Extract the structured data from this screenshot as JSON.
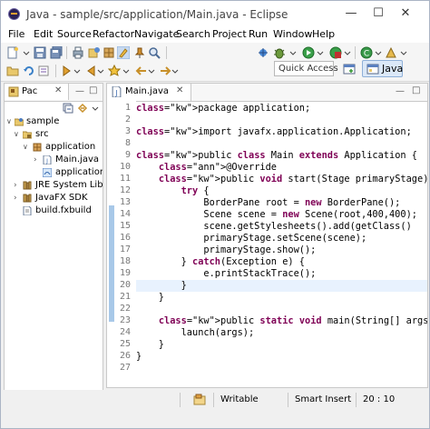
{
  "window": {
    "title": "Java - sample/src/application/Main.java - Eclipse"
  },
  "window_controls": [
    "minimize",
    "maximize",
    "close"
  ],
  "menu": [
    "File",
    "Edit",
    "Source",
    "Refactor",
    "Navigate",
    "Search",
    "Project",
    "Run",
    "Window",
    "Help"
  ],
  "toolbar": {
    "quick_access_placeholder": "Quick Access",
    "perspective_label": "Java"
  },
  "package_explorer": {
    "tab_label": "Pac",
    "tree": [
      {
        "label": "sample",
        "icon": "project-icon",
        "depth": 0,
        "expanded": true
      },
      {
        "label": "src",
        "icon": "source-folder-icon",
        "depth": 1,
        "expanded": true
      },
      {
        "label": "application",
        "icon": "package-icon",
        "depth": 2,
        "expanded": true
      },
      {
        "label": "Main.java",
        "icon": "java-file-icon",
        "depth": 3,
        "expanded": false
      },
      {
        "label": "application",
        "icon": "css-file-icon",
        "depth": 3,
        "expanded": null
      },
      {
        "label": "JRE System Library",
        "icon": "library-icon",
        "depth": 1,
        "expanded": false
      },
      {
        "label": "JavaFX SDK",
        "icon": "library-icon",
        "depth": 1,
        "expanded": false
      },
      {
        "label": "build.fxbuild",
        "icon": "file-icon",
        "depth": 1,
        "expanded": null
      }
    ]
  },
  "editor": {
    "tab_label": "Main.java",
    "current_line": 20,
    "lines": [
      {
        "n": "1",
        "text": "package application;"
      },
      {
        "n": "2",
        "text": ""
      },
      {
        "n": "3",
        "text": "import javafx.application.Application;"
      },
      {
        "n": "8",
        "text": ""
      },
      {
        "n": "9",
        "text": "public class Main extends Application {"
      },
      {
        "n": "10",
        "text": "    @Override"
      },
      {
        "n": "11",
        "text": "    public void start(Stage primaryStage) {"
      },
      {
        "n": "12",
        "text": "        try {"
      },
      {
        "n": "13",
        "text": "            BorderPane root = new BorderPane();"
      },
      {
        "n": "14",
        "text": "            Scene scene = new Scene(root,400,400);"
      },
      {
        "n": "15",
        "text": "            scene.getStylesheets().add(getClass()"
      },
      {
        "n": "16",
        "text": "            primaryStage.setScene(scene);"
      },
      {
        "n": "17",
        "text": "            primaryStage.show();"
      },
      {
        "n": "18",
        "text": "        } catch(Exception e) {"
      },
      {
        "n": "19",
        "text": "            e.printStackTrace();"
      },
      {
        "n": "20",
        "text": "        }"
      },
      {
        "n": "21",
        "text": "    }"
      },
      {
        "n": "22",
        "text": ""
      },
      {
        "n": "23",
        "text": "    public static void main(String[] args) {"
      },
      {
        "n": "24",
        "text": "        launch(args);"
      },
      {
        "n": "25",
        "text": "    }"
      },
      {
        "n": "26",
        "text": "}"
      },
      {
        "n": "27",
        "text": ""
      }
    ]
  },
  "status": {
    "mode": "Writable",
    "insert": "Smart Insert",
    "position": "20 : 10"
  },
  "colors": {
    "keyword": "#7f0055",
    "annotation": "#646464",
    "current_line": "#e8f2fe",
    "perspective_active": "#dbe8f8"
  }
}
